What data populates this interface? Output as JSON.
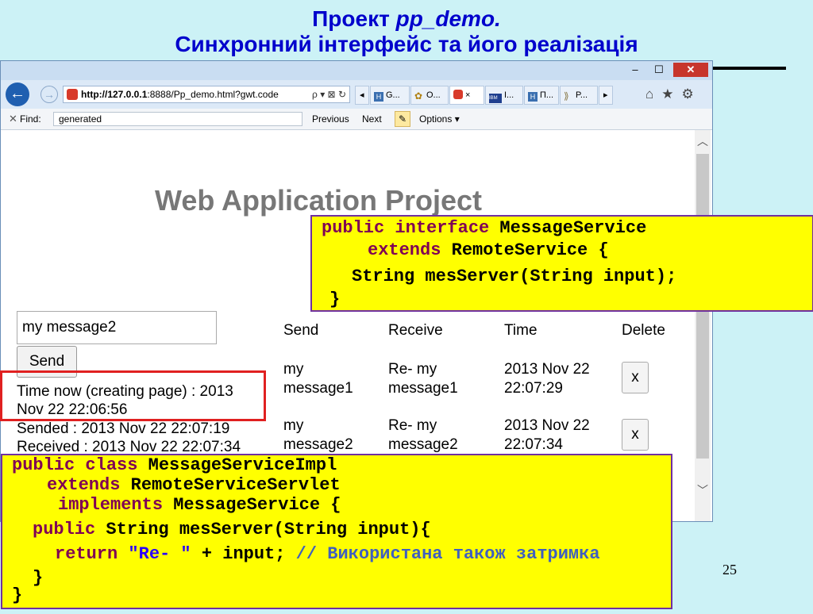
{
  "slide": {
    "title_prefix": "Проект ",
    "title_project": "pp_demo.",
    "subtitle": "Синхронний інтерфейс та його реалізація",
    "page_number": "25"
  },
  "window": {
    "minimize": "–",
    "maximize": "☐",
    "close": "✕"
  },
  "navbar": {
    "back_icon": "back-arrow-icon",
    "url_host": "http://127.0.0.1",
    "url_rest": ":8888/Pp_demo.html?gwt.code",
    "addr_tools": "ρ ▾ ⊠ ↻",
    "tabs": [
      {
        "label": "G...",
        "icon_color": "#3a6fb0",
        "glyph": "H"
      },
      {
        "label": "O...",
        "icon_color": "#d4a017",
        "glyph": "✿"
      },
      {
        "label": "×",
        "icon_color": "#d83a2a",
        "glyph": ""
      },
      {
        "label": "I...",
        "icon_color": "#1f3f8f",
        "glyph": "IBM"
      },
      {
        "label": "П...",
        "icon_color": "#3a6fb0",
        "glyph": "H"
      },
      {
        "label": "P...",
        "icon_color": "#8a7a4a",
        "glyph": "⟫"
      }
    ],
    "tab_scroll_left": "◂",
    "tab_scroll_right": "▸",
    "right_icons": "⌂★⚙"
  },
  "findbar": {
    "close": "✕",
    "label": "Find:",
    "value": "generated",
    "previous": "Previous",
    "next": "Next",
    "pencil": "✎",
    "options": "Options ▾"
  },
  "app": {
    "title": "Web Application Project",
    "message_value": "my message2",
    "send_label": "Send",
    "time_now_1": "Time now (creating page) : 2013",
    "time_now_2": "Nov 22 22:06:56",
    "sended": "Sended : 2013 Nov 22 22:07:19",
    "received": "Received : 2013 Nov 22 22:07:34",
    "columns": [
      "Send",
      "Receive",
      "Time",
      "Delete"
    ],
    "rows": [
      {
        "send_1": "my",
        "send_2": "message1",
        "receive_1": "Re- my",
        "receive_2": "message1",
        "time_1": "2013 Nov 22",
        "time_2": "22:07:29",
        "delete": "x"
      },
      {
        "send_1": "my",
        "send_2": "message2",
        "receive_1": "Re- my",
        "receive_2": "message2",
        "time_1": "2013 Nov 22",
        "time_2": "22:07:34",
        "delete": "x"
      }
    ]
  },
  "code_interface": {
    "l1_kw": "public interface",
    "l1_rest": " MessageService",
    "l2_kw": "extends",
    "l2_rest": " RemoteService {",
    "l3": "String mesServer(String input);",
    "l4": "}"
  },
  "code_impl": {
    "l1_kw": "public class",
    "l1_rest": " MessageServiceImpl",
    "l2_kw": "extends",
    "l2_rest": " RemoteServiceServlet",
    "l3_kw": "implements",
    "l3_rest": " MessageService {",
    "l4_kw": "public",
    "l4_rest": " String mesServer(String input){",
    "l5_kw": "return",
    "l5_str": "\"Re- \"",
    "l5_rest": " + input; ",
    "l5_comment": "// Використана також затримка",
    "l6": "}",
    "l7": "}"
  }
}
